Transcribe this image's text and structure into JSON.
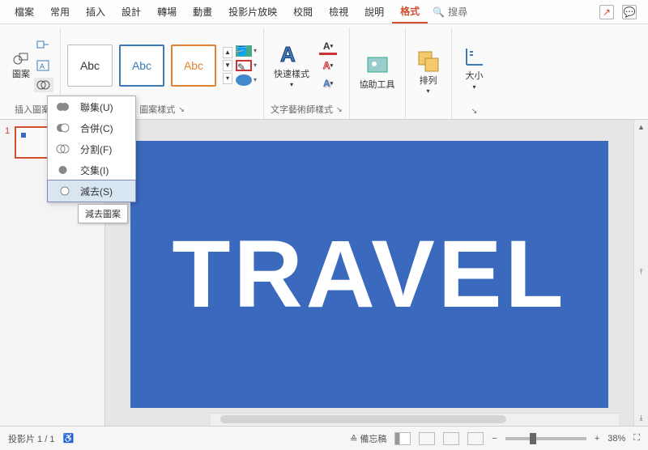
{
  "menu": {
    "tabs": [
      "檔案",
      "常用",
      "插入",
      "設計",
      "轉場",
      "動畫",
      "投影片放映",
      "校閱",
      "檢視",
      "說明",
      "格式"
    ],
    "active_index": 10,
    "search_label": "搜尋"
  },
  "ribbon": {
    "insert_shape": {
      "label": "插入圖案",
      "shapes_label": "圖案"
    },
    "shape_styles": {
      "label": "圖案樣式",
      "swatch_text": "Abc"
    },
    "wordart_styles": {
      "label": "文字藝術師樣式",
      "quick_styles": "快速樣式"
    },
    "accessibility": {
      "label": "協助工具"
    },
    "arrange": {
      "label": "排列"
    },
    "size": {
      "label": "大小"
    }
  },
  "merge_menu": {
    "items": [
      {
        "label": "聯集(U)"
      },
      {
        "label": "合併(C)"
      },
      {
        "label": "分割(F)"
      },
      {
        "label": "交集(I)"
      },
      {
        "label": "減去(S)"
      }
    ],
    "hover_index": 4,
    "tooltip": "減去圖案"
  },
  "slide": {
    "text": "TRAVEL",
    "thumb_number": "1"
  },
  "status": {
    "slide_counter": "投影片 1 / 1",
    "notes": "備忘稿",
    "zoom": "38%"
  }
}
